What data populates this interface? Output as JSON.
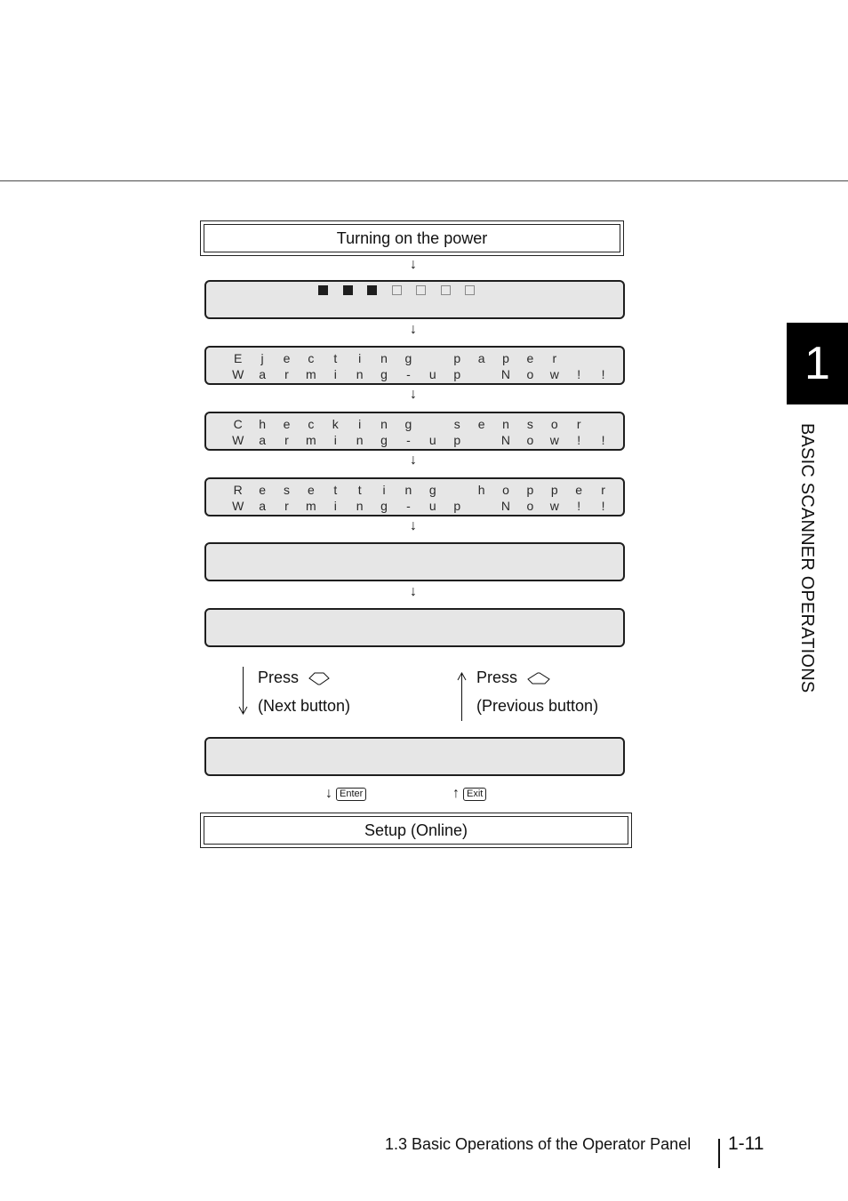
{
  "header_rule": true,
  "flow": {
    "start_label": "Turning on the power",
    "arrow_down": "↓",
    "arrow_up": "↑",
    "progress": {
      "filled": 3,
      "total": 7
    },
    "lcd_screens": [
      {
        "line1": "Ejecting paper",
        "line2": "Warming-up Now!!"
      },
      {
        "line1": "Checking sensor",
        "line2": "Warming-up Now!!"
      },
      {
        "line1": "Resetting hopper",
        "line2": "Warming-up Now!!"
      },
      {
        "line1": "",
        "line2": ""
      },
      {
        "line1": "",
        "line2": ""
      },
      {
        "line1": "",
        "line2": ""
      }
    ],
    "next": {
      "press": "Press",
      "label": "(Next button)"
    },
    "previous": {
      "press": "Press",
      "label": "(Previous button)"
    },
    "enter_key": "Enter",
    "exit_key": "Exit",
    "end_label": "Setup (Online)"
  },
  "chapter": {
    "number": "1",
    "title": "BASIC SCANNER OPERATIONS"
  },
  "footer": {
    "section": "1.3 Basic Operations of the Operator Panel",
    "page": "1-11"
  }
}
